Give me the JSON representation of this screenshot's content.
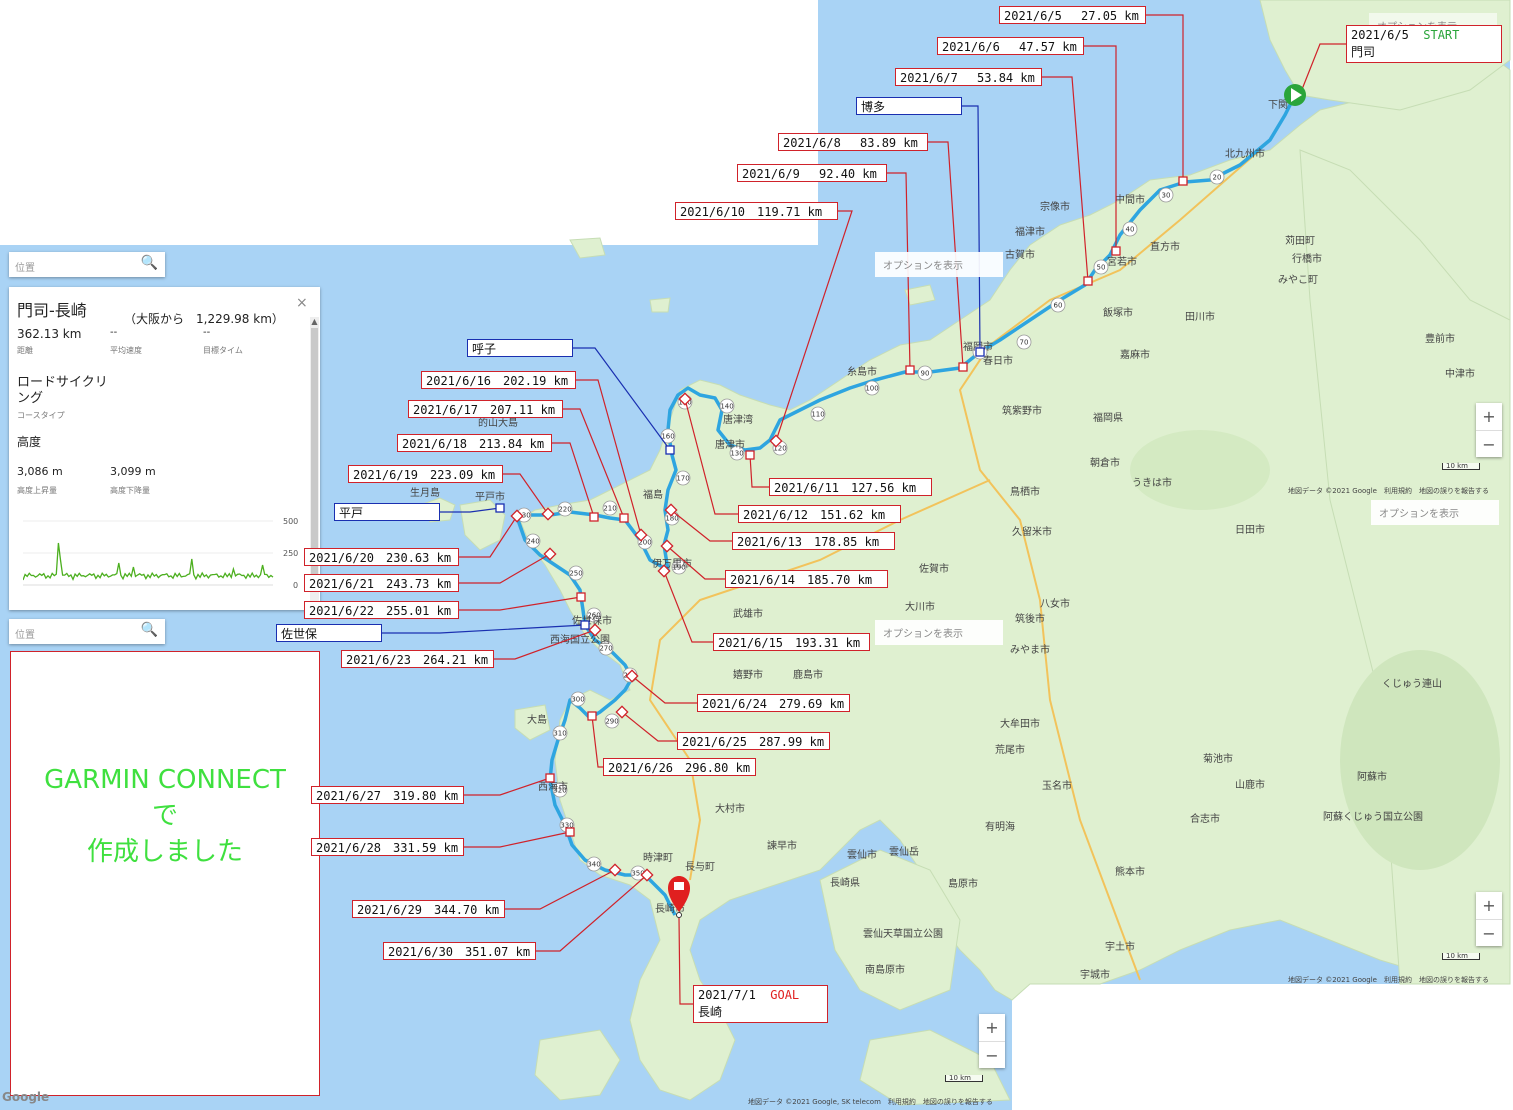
{
  "route_panel": {
    "search_placeholder": "位置",
    "title": "門司-長崎",
    "from_osaka": "（大阪から　1,229.98 km）",
    "close": "×",
    "distance": "362.13 km",
    "distance_label": "距離",
    "avg_speed": "--",
    "avg_speed_label": "平均速度",
    "target_time": "--",
    "target_time_label": "目標タイム",
    "course_type": "ロードサイクリング",
    "course_type_label": "コースタイプ",
    "elevation_heading": "高度",
    "ascent": "3,086 m",
    "ascent_label": "高度上昇量",
    "descent": "3,099 m",
    "descent_label": "高度下降量",
    "chart_ticks": [
      "500",
      "250",
      "0"
    ],
    "chart_color": "#4caf1f"
  },
  "second_search_placeholder": "位置",
  "options_label": "オプションを表示",
  "garmin_note": {
    "line1": "GARMIN CONNECT",
    "line2": "で",
    "line3": "作成しました"
  },
  "start_label": {
    "date": "2021/6/5",
    "tag": "START",
    "place": "門司"
  },
  "goal_label": {
    "date": "2021/7/1",
    "tag": "GOAL",
    "place": "長崎"
  },
  "daily_labels": [
    "2021/6/5　 27.05 km",
    "2021/6/6　 47.57 km",
    "2021/6/7　 53.84 km",
    "2021/6/8　 83.89 km",
    "2021/6/9　 92.40 km",
    "2021/6/10　119.71 km",
    "2021/6/11　127.56 km",
    "2021/6/12　151.62 km",
    "2021/6/13　178.85 km",
    "2021/6/14　185.70 km",
    "2021/6/15　193.31 km",
    "2021/6/16　202.19 km",
    "2021/6/17　207.11 km",
    "2021/6/18　213.84 km",
    "2021/6/19　223.09 km",
    "2021/6/20　230.63 km",
    "2021/6/21　243.73 km",
    "2021/6/22　255.01 km",
    "2021/6/23　264.21 km",
    "2021/6/24　279.69 km",
    "2021/6/25　287.99 km",
    "2021/6/26　296.80 km",
    "2021/6/27　319.80 km",
    "2021/6/28　331.59 km",
    "2021/6/29　344.70 km",
    "2021/6/30　351.07 km"
  ],
  "place_labels": [
    "博多",
    "呼子",
    "平戸",
    "佐世保"
  ],
  "route_markers": [
    "20",
    "30",
    "40",
    "50",
    "60",
    "70",
    "80",
    "90",
    "100",
    "110",
    "120",
    "130",
    "140",
    "150",
    "160",
    "170",
    "180",
    "190",
    "200",
    "210",
    "220",
    "230",
    "240",
    "250",
    "260",
    "270",
    "280",
    "290",
    "300",
    "310",
    "320",
    "330",
    "340",
    "350"
  ],
  "map_places": [
    "北九州市",
    "下関",
    "宗像市",
    "福津市",
    "古賀市",
    "福岡市",
    "糸島市",
    "唐津市",
    "春日市",
    "筑紫野市",
    "福岡県",
    "飯塚市",
    "田川市",
    "嘉麻市",
    "朝倉市",
    "鳥栖市",
    "久留米市",
    "佐賀市",
    "武雄市",
    "大川市",
    "八女市",
    "筑後市",
    "みやま市",
    "大牟田市",
    "荒尾市",
    "玉名市",
    "熊本市",
    "宇土市",
    "宇城市",
    "長崎県",
    "長崎市",
    "大村市",
    "諫早市",
    "雲仙市",
    "島原市",
    "南島原市",
    "佐世保市",
    "平戸市",
    "伊万里市",
    "嬉野市",
    "鹿島市",
    "西海市",
    "時津町",
    "長与町",
    "行橋市",
    "中津市",
    "豊前市",
    "日田市",
    "山鹿市",
    "菊池市",
    "合志市",
    "阿蘇市",
    "うきは市",
    "直方市",
    "宮若市",
    "中間市",
    "みやこ町",
    "苅田町",
    "生月島",
    "大島",
    "的山大島",
    "福島",
    "くじゅう連山",
    "雲仙岳",
    "雲仙天草国立公園",
    "西海国立公園",
    "阿蘇くじゅう国立公園",
    "有明海",
    "唐津湾"
  ],
  "zoom": {
    "plus": "+",
    "minus": "−"
  },
  "scale_labels": [
    "10 km",
    "10 km",
    "10 km"
  ],
  "attribution_top": "地図データ ©2021 Google　利用規約　地図の誤りを報告する",
  "attribution_mid": "地図データ ©2021 Google　利用規約　地図の誤りを報告する",
  "attribution_bottom": "地図データ ©2021 Google, SK telecom　利用規約　地図の誤りを報告する",
  "google_logo": "Google",
  "colors": {
    "sea": "#a9d3f5",
    "land": "#dff0d0",
    "route": "#2ea5e0",
    "red_box": "#d0222a",
    "blue_box": "#1a2fb0",
    "start": "#2aa53a",
    "goal": "#e02020"
  }
}
